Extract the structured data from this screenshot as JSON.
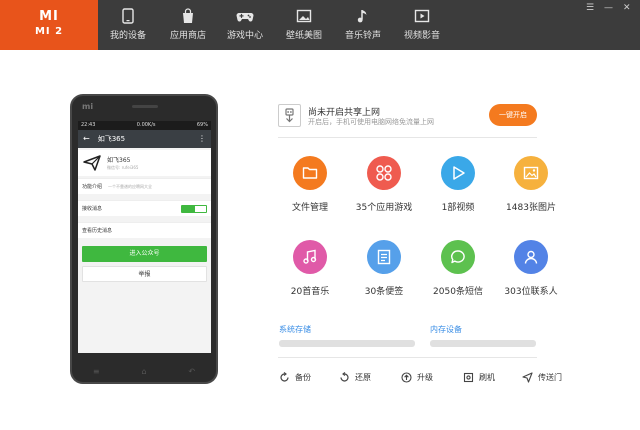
{
  "brand": {
    "logo": "MI",
    "model": "MI 2",
    "color": "#e8541b"
  },
  "nav": [
    {
      "label": "我的设备",
      "icon": "phone-icon"
    },
    {
      "label": "应用商店",
      "icon": "bag-icon"
    },
    {
      "label": "游戏中心",
      "icon": "gamepad-icon"
    },
    {
      "label": "壁纸美图",
      "icon": "picture-icon"
    },
    {
      "label": "音乐铃声",
      "icon": "music-note-icon"
    },
    {
      "label": "视频影音",
      "icon": "play-video-icon"
    }
  ],
  "window_controls": {
    "menu": "☰",
    "minimize": "—",
    "close": "✕"
  },
  "phone": {
    "logo": "mi",
    "status_time": "22:43",
    "status_speed": "0.00K/s",
    "status_battery": "69%",
    "title": "如飞365",
    "back": "←",
    "more": "⋮",
    "account_name": "如飞365",
    "account_id": "微信号: rufei365",
    "intro_label": "功能介绍",
    "intro_text": "一个不靠谱的应聘网大全",
    "receive_label": "接收消息",
    "history_label": "查看历史消息",
    "enter_button": "进入公众号",
    "report_button": "举报"
  },
  "share": {
    "title": "尚未开启共享上网",
    "subtitle": "开启后，手机可使用电脑网络免流量上网",
    "button": "一键开启"
  },
  "grid": [
    {
      "label": "文件管理",
      "icon": "folder-icon",
      "color": "#f47a1f"
    },
    {
      "label": "35个应用游戏",
      "icon": "apps-icon",
      "color": "#ef5b4f"
    },
    {
      "label": "1部视频",
      "icon": "play-icon",
      "color": "#3aa8e8"
    },
    {
      "label": "1483张图片",
      "icon": "image-icon",
      "color": "#f6b13d"
    },
    {
      "label": "20首音乐",
      "icon": "music-icon",
      "color": "#e05aa8"
    },
    {
      "label": "30条便签",
      "icon": "note-icon",
      "color": "#56a0ea"
    },
    {
      "label": "2050条短信",
      "icon": "chat-icon",
      "color": "#5dc14f"
    },
    {
      "label": "303位联系人",
      "icon": "contact-icon",
      "color": "#5383e6"
    }
  ],
  "storage": {
    "system_label": "系统存储",
    "internal_label": "内存设备"
  },
  "tools": [
    {
      "label": "备份",
      "icon": "backup-icon"
    },
    {
      "label": "还原",
      "icon": "restore-icon"
    },
    {
      "label": "升级",
      "icon": "upgrade-icon"
    },
    {
      "label": "刷机",
      "icon": "flash-icon"
    },
    {
      "label": "传送门",
      "icon": "portal-icon"
    }
  ]
}
